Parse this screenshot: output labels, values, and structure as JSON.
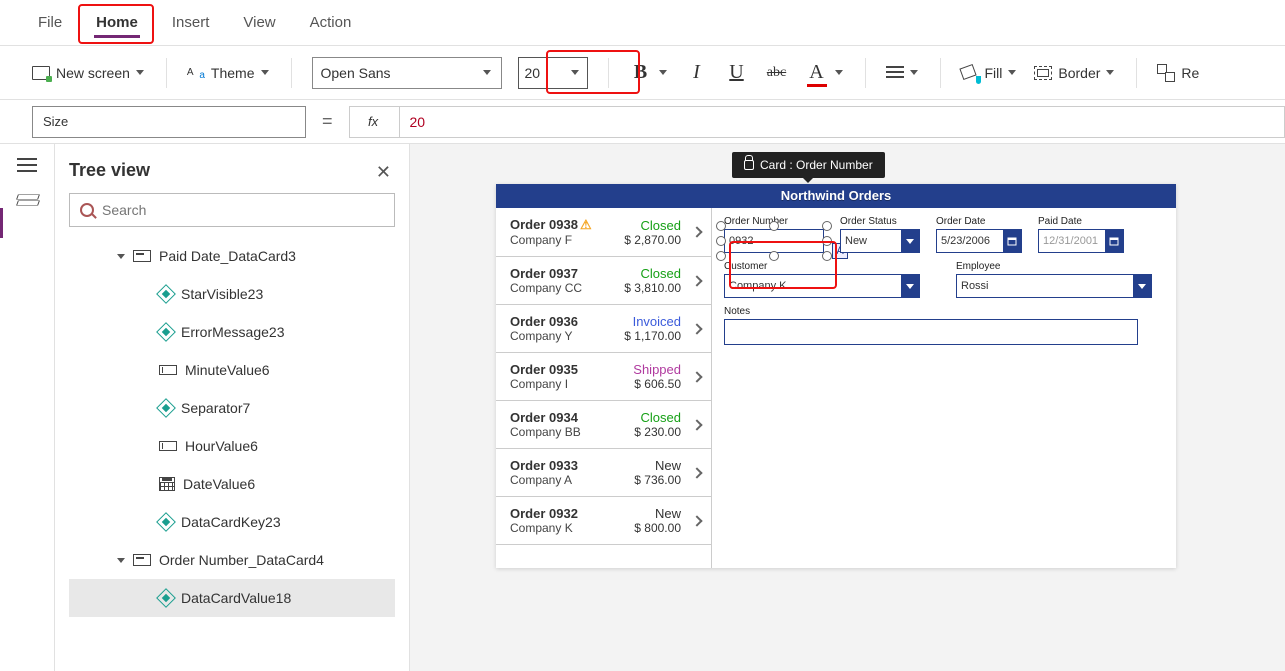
{
  "menu": {
    "tabs": [
      "File",
      "Home",
      "Insert",
      "View",
      "Action"
    ],
    "active": 1
  },
  "ribbon": {
    "newScreen": "New screen",
    "theme": "Theme",
    "font": "Open Sans",
    "fontSize": "20",
    "fill": "Fill",
    "border": "Border",
    "reorder": "Re"
  },
  "formula": {
    "property": "Size",
    "value": "20"
  },
  "tree": {
    "title": "Tree view",
    "searchPlaceholder": "Search",
    "items": [
      {
        "lvl": 1,
        "icon": "card",
        "caret": true,
        "label": "Paid Date_DataCard3"
      },
      {
        "lvl": 2,
        "icon": "pencil",
        "label": "StarVisible23"
      },
      {
        "lvl": 2,
        "icon": "pencil",
        "label": "ErrorMessage23"
      },
      {
        "lvl": 2,
        "icon": "input",
        "label": "MinuteValue6"
      },
      {
        "lvl": 2,
        "icon": "pencil",
        "label": "Separator7"
      },
      {
        "lvl": 2,
        "icon": "input",
        "label": "HourValue6"
      },
      {
        "lvl": 2,
        "icon": "cal",
        "label": "DateValue6"
      },
      {
        "lvl": 2,
        "icon": "pencil",
        "label": "DataCardKey23"
      },
      {
        "lvl": 1,
        "icon": "card",
        "caret": true,
        "label": "Order Number_DataCard4"
      },
      {
        "lvl": 2,
        "icon": "pencil",
        "label": "DataCardValue18",
        "selected": true
      }
    ]
  },
  "tooltip": "Card : Order Number",
  "appTitle": "Northwind Orders",
  "orders": [
    {
      "title": "Order 0938",
      "warn": true,
      "company": "Company F",
      "status": "Closed",
      "statusClass": "st-closed",
      "amount": "$ 2,870.00"
    },
    {
      "title": "Order 0937",
      "company": "Company CC",
      "status": "Closed",
      "statusClass": "st-closed",
      "amount": "$ 3,810.00"
    },
    {
      "title": "Order 0936",
      "company": "Company Y",
      "status": "Invoiced",
      "statusClass": "st-invoiced",
      "amount": "$ 1,170.00"
    },
    {
      "title": "Order 0935",
      "company": "Company I",
      "status": "Shipped",
      "statusClass": "st-shipped",
      "amount": "$ 606.50"
    },
    {
      "title": "Order 0934",
      "company": "Company BB",
      "status": "Closed",
      "statusClass": "st-closed",
      "amount": "$ 230.00"
    },
    {
      "title": "Order 0933",
      "company": "Company A",
      "status": "New",
      "statusClass": "st-new",
      "amount": "$ 736.00"
    },
    {
      "title": "Order 0932",
      "company": "Company K",
      "status": "New",
      "statusClass": "st-new",
      "amount": "$ 800.00"
    }
  ],
  "form": {
    "orderNumber": {
      "label": "Order Number",
      "value": "0932"
    },
    "orderStatus": {
      "label": "Order Status",
      "value": "New"
    },
    "orderDate": {
      "label": "Order Date",
      "value": "5/23/2006"
    },
    "paidDate": {
      "label": "Paid Date",
      "value": "12/31/2001"
    },
    "customer": {
      "label": "Customer",
      "value": "Company K"
    },
    "employee": {
      "label": "Employee",
      "value": "Rossi"
    },
    "notes": {
      "label": "Notes",
      "value": ""
    }
  }
}
